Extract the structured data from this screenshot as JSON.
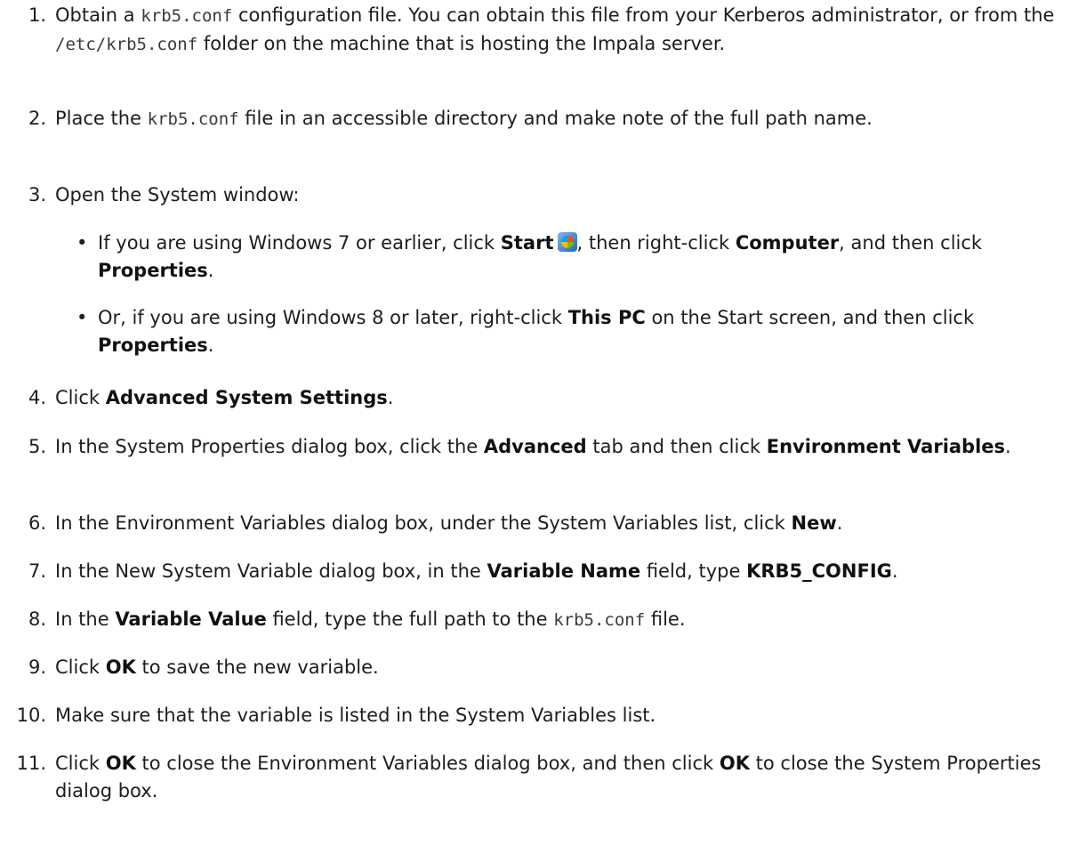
{
  "steps": [
    {
      "num": "1.",
      "p": [
        "Obtain a ",
        "krb5.conf",
        " configuration file. You can obtain this file from your Kerberos administrator, or from the ",
        "/etc/krb5.conf",
        " folder on the machine that is hosting the Impala server."
      ]
    },
    {
      "num": "2.",
      "p": [
        "Place the ",
        "krb5.conf",
        " file in an accessible directory and make note of the full path name."
      ]
    },
    {
      "num": "3.",
      "p": [
        "Open the System window:"
      ]
    },
    {
      "num": "4.",
      "p": [
        "Click ",
        "Advanced System Settings",
        "."
      ]
    },
    {
      "num": "5.",
      "p": [
        "In the System Properties dialog box, click the ",
        "Advanced",
        " tab and then click ",
        "Environment Variables",
        "."
      ]
    },
    {
      "num": "6.",
      "p": [
        "In the Environment Variables dialog box, under the System Variables list, click ",
        "New",
        "."
      ]
    },
    {
      "num": "7.",
      "p": [
        "In the New System Variable dialog box, in the ",
        "Variable Name",
        " field, type ",
        "KRB5_CONFIG",
        "."
      ]
    },
    {
      "num": "8.",
      "p": [
        "In the ",
        "Variable Value",
        " field, type the full path to the ",
        "krb5.conf",
        " file."
      ]
    },
    {
      "num": "9.",
      "p": [
        "Click ",
        "OK",
        " to save the new variable."
      ]
    },
    {
      "num": "10.",
      "p": [
        "Make sure that the variable is listed in the System Variables list."
      ]
    },
    {
      "num": "11.",
      "p": [
        "Click ",
        "OK",
        " to close the Environment Variables dialog box, and then click ",
        "OK",
        " to close the System Properties dialog box."
      ]
    }
  ],
  "substeps": [
    {
      "bullet": "•",
      "p": [
        "If you are using Windows 7 or earlier, click ",
        "Start",
        "",
        ", then right-click ",
        "Computer",
        ", and then click ",
        "Properties",
        "."
      ]
    },
    {
      "bullet": "•",
      "p": [
        "Or, if you are using Windows 8 or later, right-click ",
        "This PC",
        " on the Start screen, and then click ",
        "Properties",
        "."
      ]
    }
  ],
  "icons": {
    "start": "windows-start-orb-icon"
  }
}
